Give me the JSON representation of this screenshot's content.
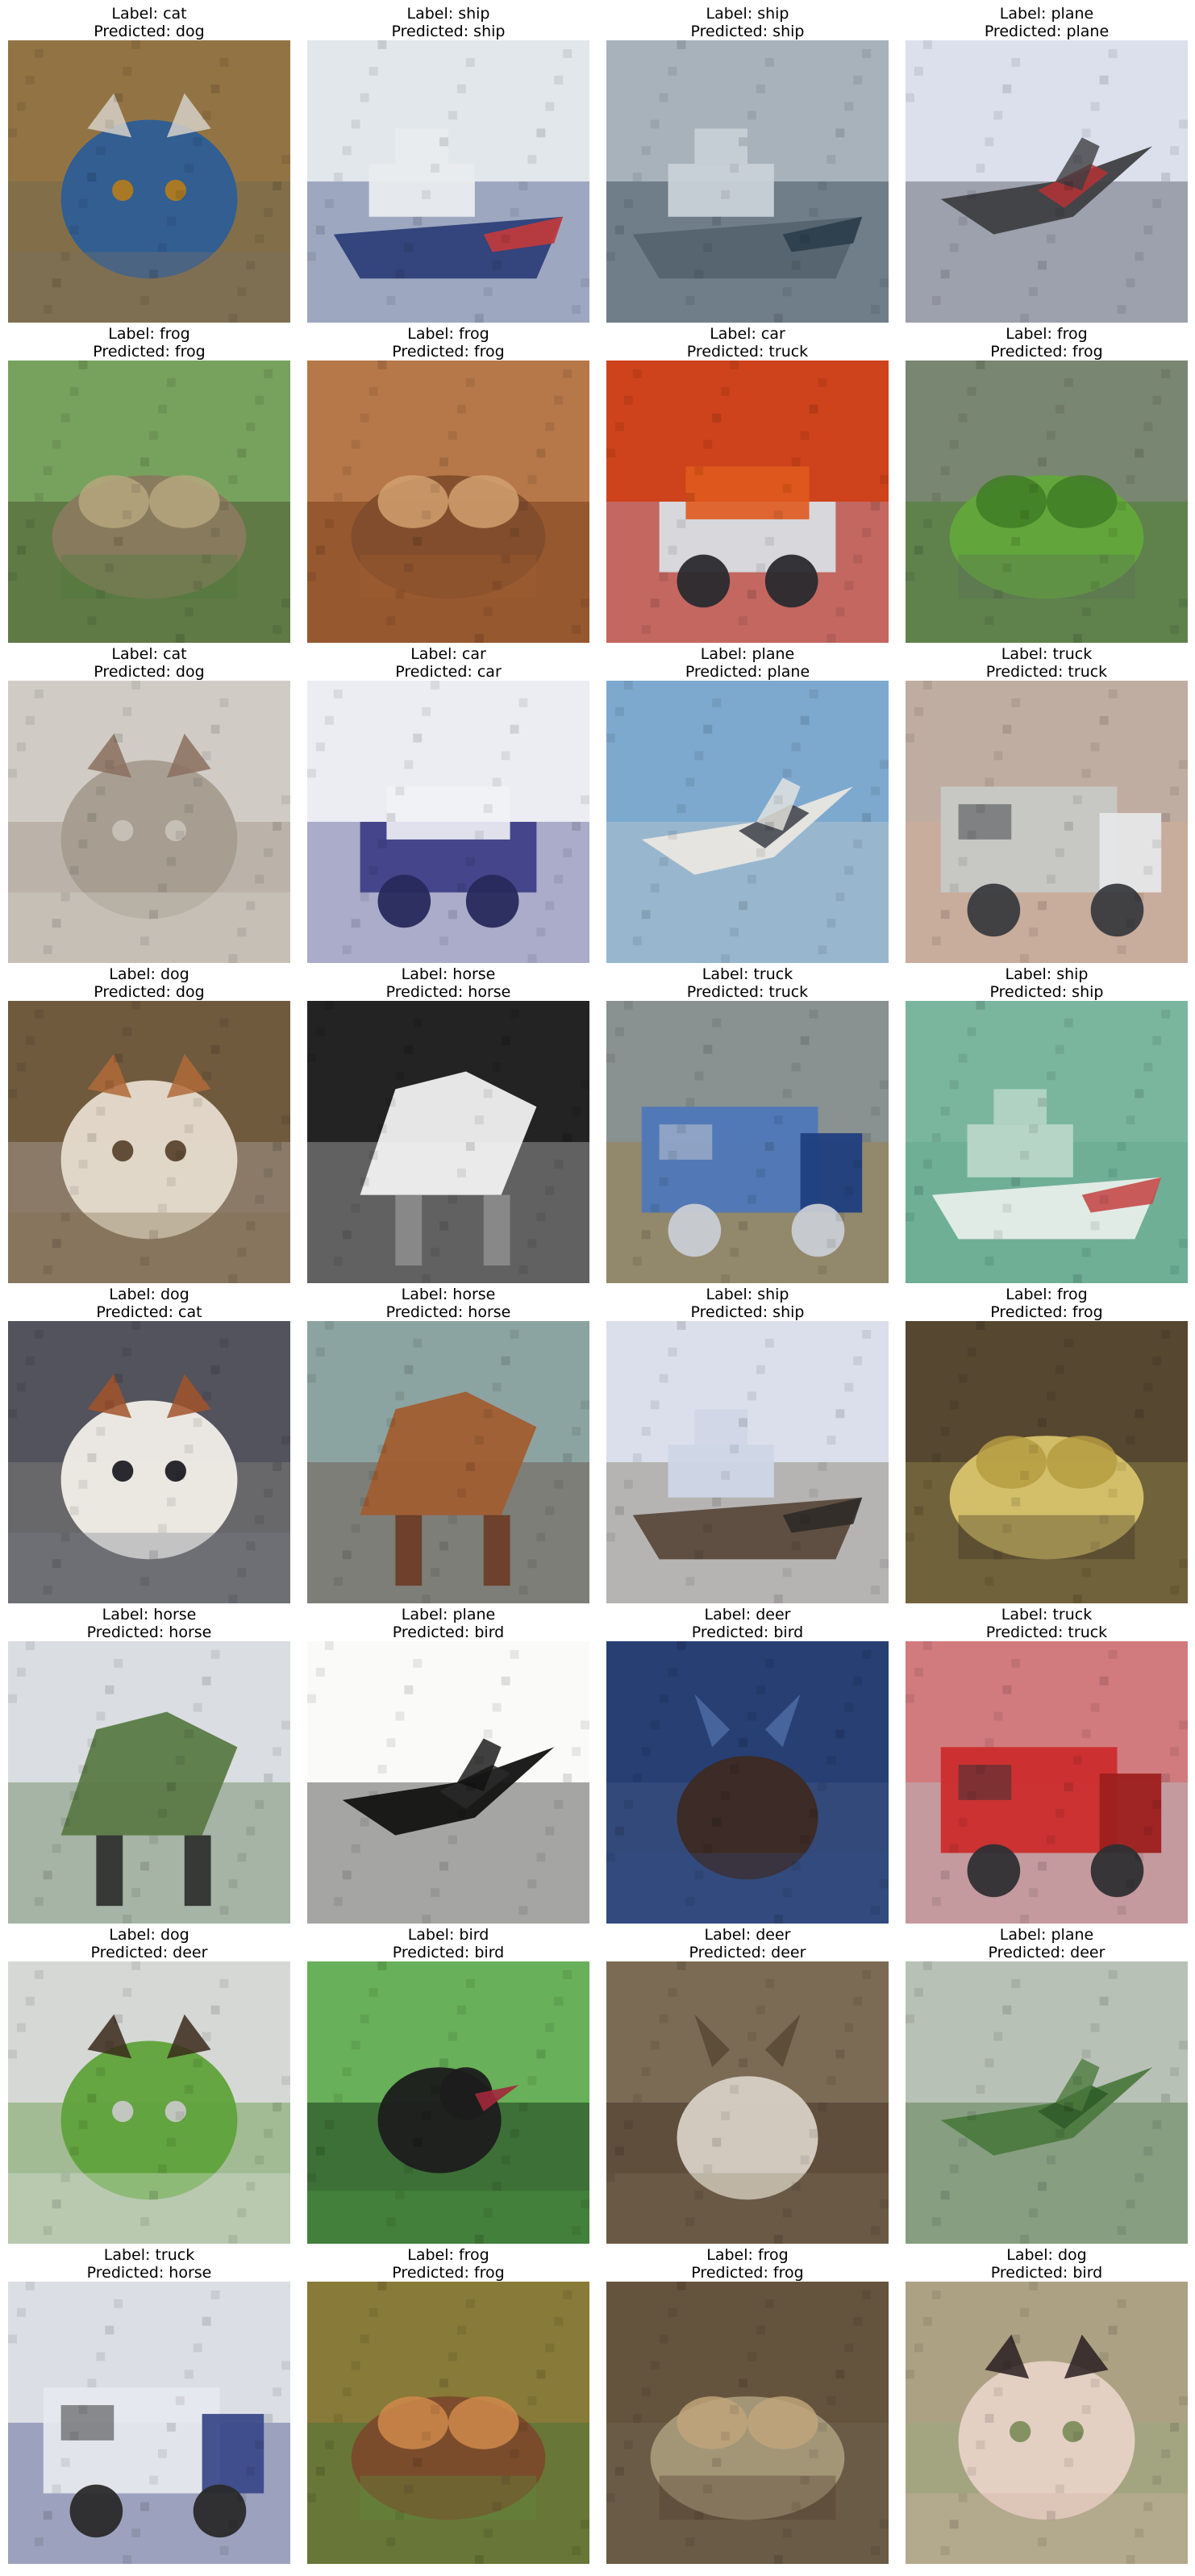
{
  "samples": [
    {
      "label": "Label: cat",
      "predicted": "Predicted: dog",
      "subject": "cat",
      "palette": [
        "#b07a20",
        "#7a6f63",
        "#2d5d97",
        "#d6d0c8"
      ]
    },
    {
      "label": "Label: ship",
      "predicted": "Predicted: ship",
      "subject": "ship",
      "palette": [
        "#d9e1e6",
        "#e9ecef",
        "#2d3f78",
        "#c43a3a"
      ]
    },
    {
      "label": "Label: ship",
      "predicted": "Predicted: ship",
      "subject": "ship",
      "palette": [
        "#7e8d98",
        "#c9d2d8",
        "#55646f",
        "#2b3d4a"
      ]
    },
    {
      "label": "Label: plane",
      "predicted": "Predicted: plane",
      "subject": "plane",
      "palette": [
        "#cfd6e7",
        "#e7eaf2",
        "#3e3f42",
        "#b43236"
      ]
    },
    {
      "label": "Label: frog",
      "predicted": "Predicted: frog",
      "subject": "frog",
      "palette": [
        "#4a7a3a",
        "#9cc37a",
        "#8a7a5e",
        "#b6a77e"
      ]
    },
    {
      "label": "Label: frog",
      "predicted": "Predicted: frog",
      "subject": "frog",
      "palette": [
        "#a45e32",
        "#c78e5d",
        "#7f4d2c",
        "#d2a070"
      ]
    },
    {
      "label": "Label: car",
      "predicted": "Predicted: truck",
      "subject": "car",
      "palette": [
        "#b9281b",
        "#e05a1d",
        "#d8dde3",
        "#2a2a2e"
      ]
    },
    {
      "label": "Label: frog",
      "predicted": "Predicted: frog",
      "subject": "frog",
      "palette": [
        "#5f6e58",
        "#8e9a86",
        "#62a83a",
        "#3f7d25"
      ]
    },
    {
      "label": "Label: cat",
      "predicted": "Predicted: dog",
      "subject": "cat",
      "palette": [
        "#c6c1b8",
        "#d9d6cf",
        "#a59c8f",
        "#8b6f5e"
      ]
    },
    {
      "label": "Label: car",
      "predicted": "Predicted: car",
      "subject": "car",
      "palette": [
        "#e5e6ef",
        "#f2f2f6",
        "#3e3f86",
        "#28295c"
      ]
    },
    {
      "label": "Label: plane",
      "predicted": "Predicted: plane",
      "subject": "plane",
      "palette": [
        "#6e9ec7",
        "#8bb3d5",
        "#e9e6e0",
        "#3b3f46"
      ]
    },
    {
      "label": "Label: truck",
      "predicted": "Predicted: truck",
      "subject": "truck",
      "palette": [
        "#b98c74",
        "#c7c8c6",
        "#e6e7e9",
        "#3a3b3f"
      ]
    },
    {
      "label": "Label: dog",
      "predicted": "Predicted: dog",
      "subject": "dog",
      "palette": [
        "#5a4630",
        "#816c4a",
        "#e6dccd",
        "#b06a38"
      ]
    },
    {
      "label": "Label: horse",
      "predicted": "Predicted: horse",
      "subject": "horse",
      "palette": [
        "#151515",
        "#2f2f2f",
        "#f1f1f1",
        "#8d8d8d"
      ]
    },
    {
      "label": "Label: truck",
      "predicted": "Predicted: truck",
      "subject": "truck",
      "palette": [
        "#d0b060",
        "#4f78b9",
        "#1f3f80",
        "#c9cdd4"
      ]
    },
    {
      "label": "Label: ship",
      "predicted": "Predicted: ship",
      "subject": "ship",
      "palette": [
        "#2e8e6b",
        "#b9d7c9",
        "#e6eee9",
        "#c64a4a"
      ]
    },
    {
      "label": "Label: dog",
      "predicted": "Predicted: cat",
      "subject": "dog",
      "palette": [
        "#1f1f25",
        "#7b7e8c",
        "#f2efe9",
        "#a2542a"
      ]
    },
    {
      "label": "Label: horse",
      "predicted": "Predicted: horse",
      "subject": "horse",
      "palette": [
        "#6a8f9f",
        "#a7b6a3",
        "#a15e32",
        "#6b3b22"
      ]
    },
    {
      "label": "Label: ship",
      "predicted": "Predicted: ship",
      "subject": "ship",
      "palette": [
        "#e8ebf3",
        "#cfd6e6",
        "#5a4a3c",
        "#2f2a28"
      ]
    },
    {
      "label": "Label: frog",
      "predicted": "Predicted: frog",
      "subject": "frog",
      "palette": [
        "#3a2f22",
        "#6d5b3c",
        "#d8c46b",
        "#b59c42"
      ]
    },
    {
      "label": "Label: horse",
      "predicted": "Predicted: horse",
      "subject": "horse",
      "palette": [
        "#ced3d8",
        "#e3e6ea",
        "#5a7a46",
        "#2b2b2b"
      ]
    },
    {
      "label": "Label: plane",
      "predicted": "Predicted: bird",
      "subject": "plane",
      "palette": [
        "#f4f4f2",
        "#ffffff",
        "#121212",
        "#2a2a2a"
      ]
    },
    {
      "label": "Label: deer",
      "predicted": "Predicted: bird",
      "subject": "deer",
      "palette": [
        "#1d2d58",
        "#2f4f8a",
        "#5e7fb7",
        "#3d2a22"
      ]
    },
    {
      "label": "Label: truck",
      "predicted": "Predicted: truck",
      "subject": "truck",
      "palette": [
        "#d9dce2",
        "#cc2c2c",
        "#9d1f1f",
        "#2f2f33"
      ]
    },
    {
      "label": "Label: dog",
      "predicted": "Predicted: deer",
      "subject": "dog",
      "palette": [
        "#c6c8c5",
        "#e3e5e3",
        "#5fa23a",
        "#3a2a1a"
      ]
    },
    {
      "label": "Label: bird",
      "predicted": "Predicted: bird",
      "subject": "bird",
      "palette": [
        "#4f9d45",
        "#7dc06a",
        "#1c1c1c",
        "#a2283b"
      ]
    },
    {
      "label": "Label: deer",
      "predicted": "Predicted: deer",
      "subject": "deer",
      "palette": [
        "#6b5a45",
        "#8a7a60",
        "#4a3a2a",
        "#d7d0c4"
      ]
    },
    {
      "label": "Label: plane",
      "predicted": "Predicted: deer",
      "subject": "plane",
      "palette": [
        "#a7b1a5",
        "#c6cec4",
        "#4c7a3f",
        "#2d5a27"
      ]
    },
    {
      "label": "Label: truck",
      "predicted": "Predicted: horse",
      "subject": "truck",
      "palette": [
        "#cfd2d9",
        "#e6e8ee",
        "#3b4a8a",
        "#2a2a2a"
      ]
    },
    {
      "label": "Label: frog",
      "predicted": "Predicted: frog",
      "subject": "frog",
      "palette": [
        "#5f8e3e",
        "#a96a34",
        "#7b4a2b",
        "#d08a4b"
      ]
    },
    {
      "label": "Label: frog",
      "predicted": "Predicted: frog",
      "subject": "frog",
      "palette": [
        "#4a3a2a",
        "#7b6a4d",
        "#a79a7a",
        "#c0a47a"
      ]
    },
    {
      "label": "Label: dog",
      "predicted": "Predicted: bird",
      "subject": "dog",
      "palette": [
        "#7e8e5c",
        "#d2b3a4",
        "#e7d2c6",
        "#2a1f22"
      ]
    }
  ]
}
